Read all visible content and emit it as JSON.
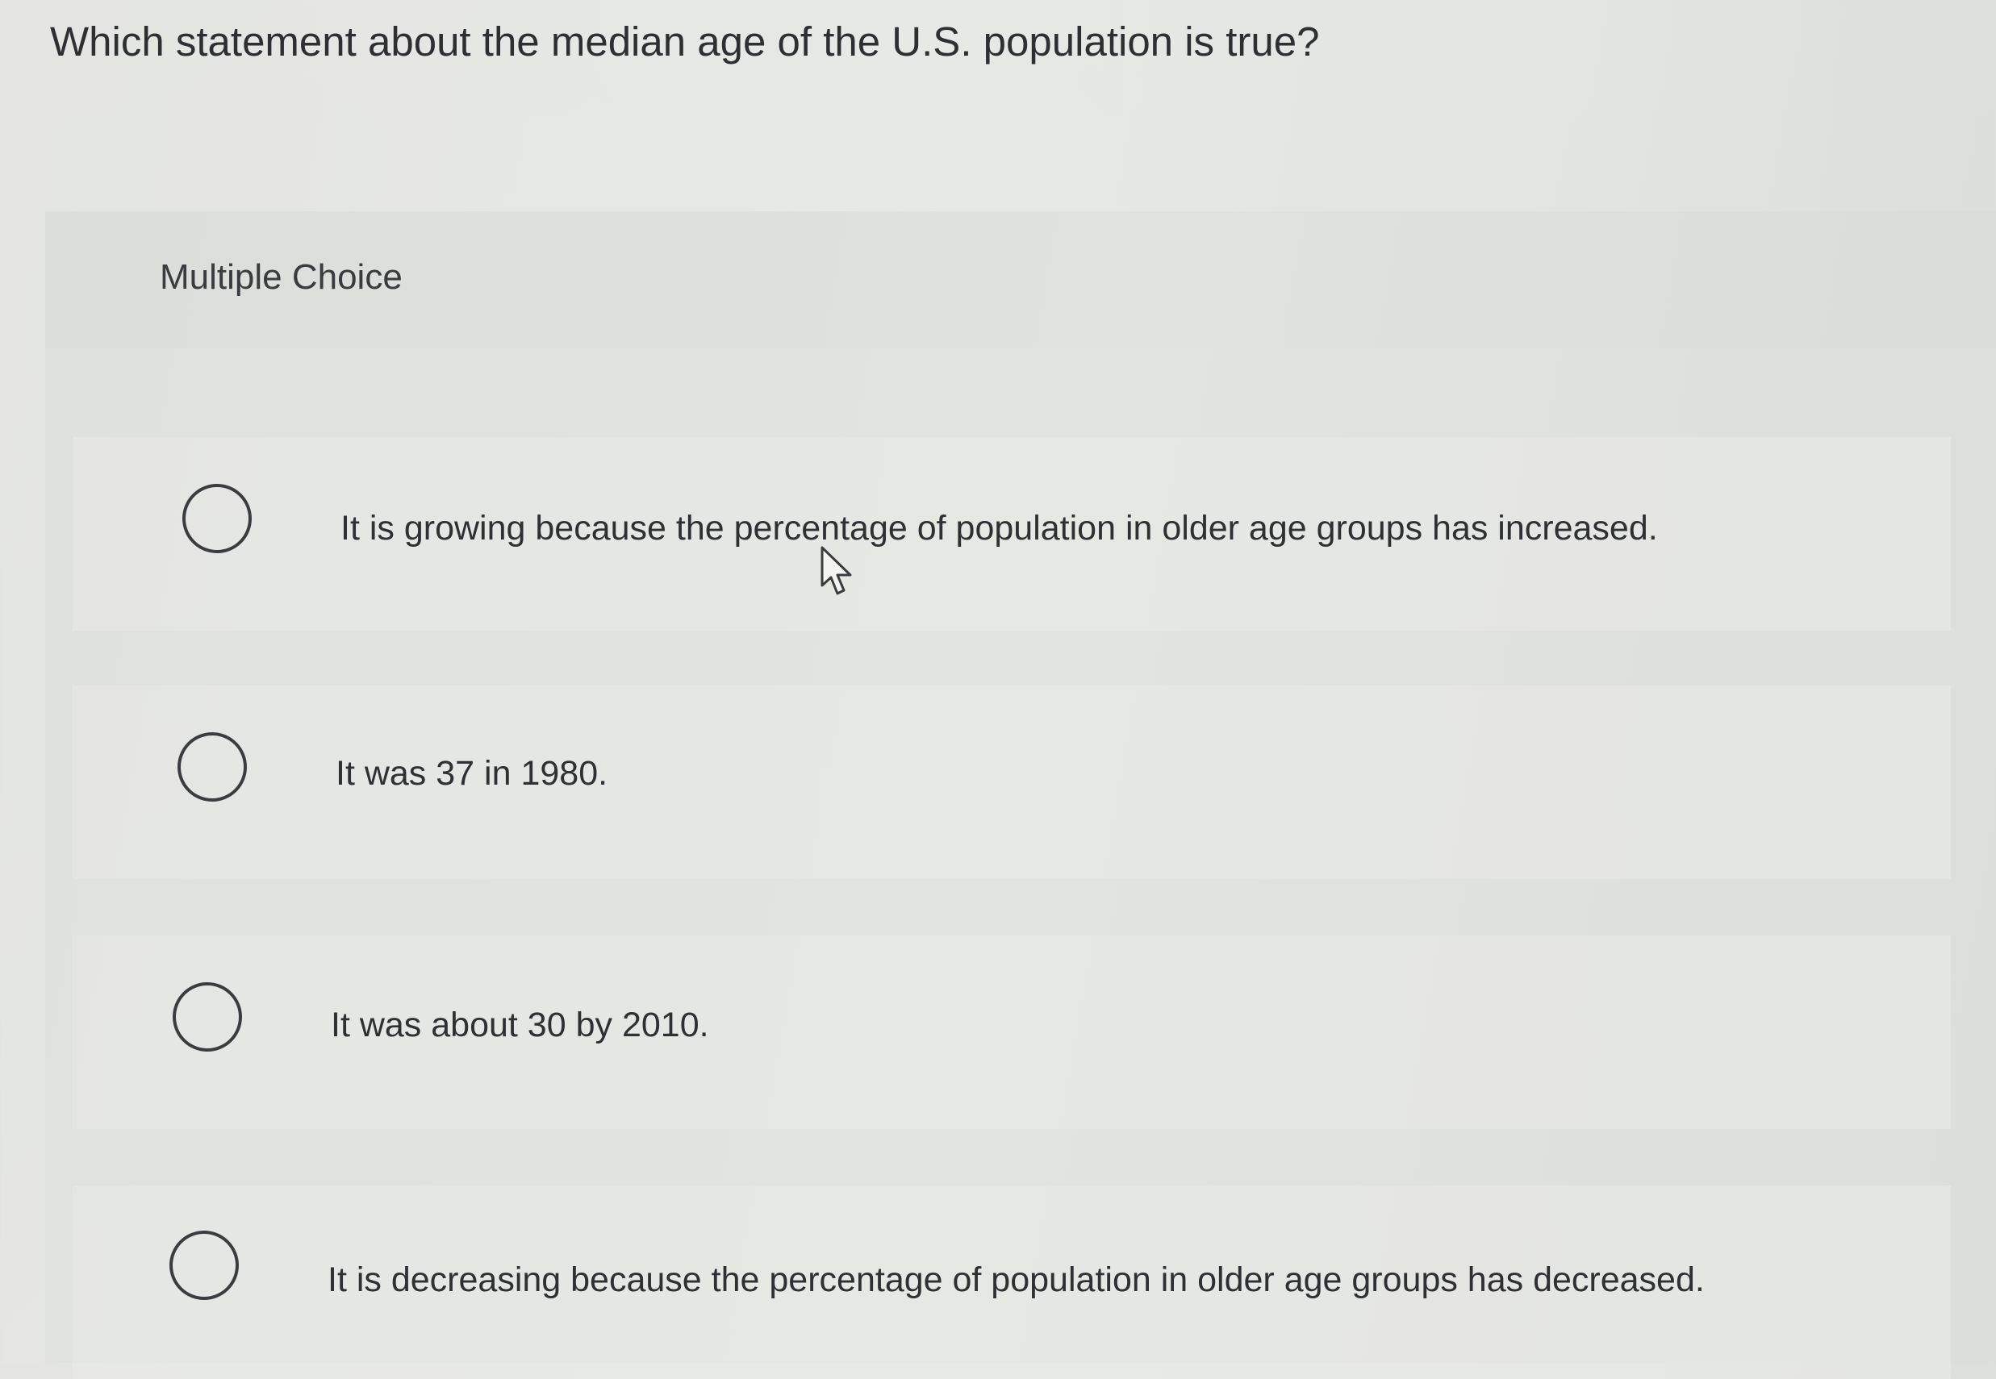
{
  "question": {
    "text": "Which statement about the median age of the U.S. population is true?"
  },
  "section": {
    "label": "Multiple Choice"
  },
  "options": [
    {
      "text": "It is growing because the percentage of population in older age groups has increased."
    },
    {
      "text": "It was 37 in 1980."
    },
    {
      "text": "It was about 30 by 2010."
    },
    {
      "text": "It is decreasing because the percentage of population in older age groups has decreased."
    }
  ],
  "colors": {
    "text": "#2f3033",
    "radio_border": "#3b3c3f",
    "background": "#e4e5e2"
  },
  "icons": {
    "radio": "radio-unselected-icon",
    "cursor": "mouse-pointer-icon"
  }
}
